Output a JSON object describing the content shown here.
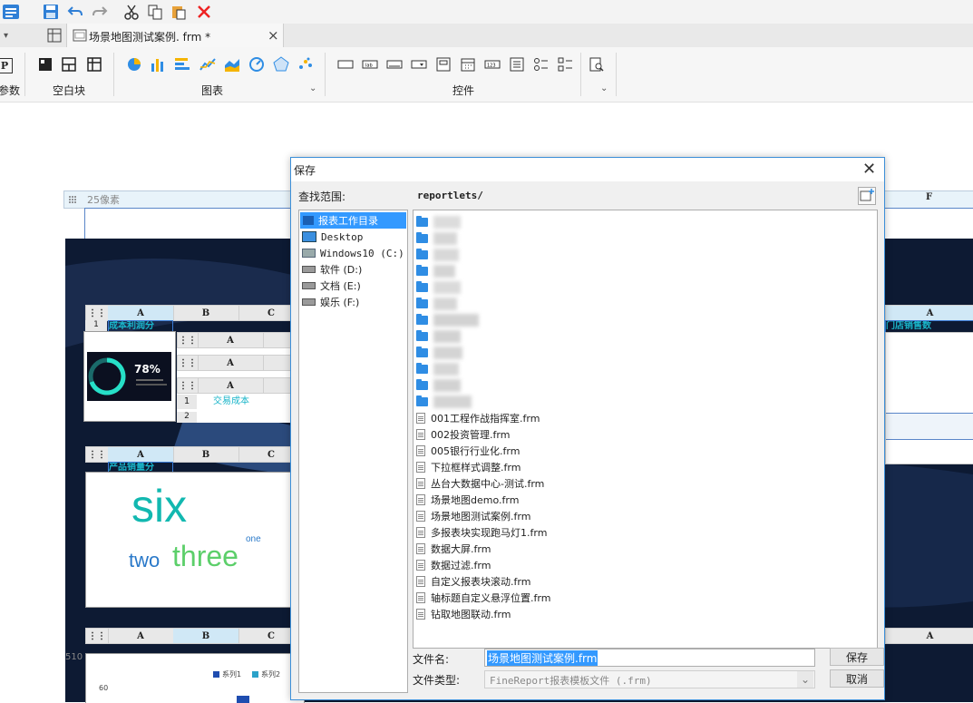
{
  "toolbar": {
    "icons": [
      "app-menu-icon",
      "save-icon",
      "undo-icon",
      "redo-icon",
      "cut-icon",
      "copy-icon",
      "paste-icon",
      "delete-icon"
    ]
  },
  "tabs": {
    "document_tab": "场景地图测试案例. frm *",
    "close_glyph": "×"
  },
  "ribbon": {
    "param_label": "参数",
    "param_icon_text": "P",
    "blank_block_label": "空白块",
    "chart_label": "图表",
    "widget_label": "控件"
  },
  "canvas": {
    "top_note": "25像素",
    "col_f": "F",
    "header_a": "A",
    "header_b": "B",
    "header_c": "C",
    "row1": "1",
    "row2": "2",
    "cell_left_1": "成本利润分",
    "cell_left_2": "产品销量分",
    "cell_right": "门店销售数",
    "cell_trade": "交易成本",
    "gauge_percent": "78%",
    "wordcloud": {
      "big": "six",
      "mid1": "two",
      "mid2": "three",
      "small": "one"
    },
    "bottom_note": "510",
    "legend1": "系列1",
    "legend2": "系列2",
    "axis_60": "60"
  },
  "dialog": {
    "title": "保存",
    "lookin_label": "查找范围:",
    "path": "reportlets/",
    "locations": [
      "报表工作目录",
      "Desktop",
      "Windows10 (C:)",
      "软件 (D:)",
      "文档 (E:)",
      "娱乐 (F:)"
    ],
    "files": [
      "001工程作战指挥室.frm",
      "002投资管理.frm",
      "005银行行业化.frm",
      "下拉框样式调整.frm",
      "丛台大数据中心-测试.frm",
      "场景地图demo.frm",
      "场景地图测试案例.frm",
      "多报表块实现跑马灯1.frm",
      "数据大屏.frm",
      "数据过滤.frm",
      "自定义报表块滚动.frm",
      "轴标题自定义悬浮位置.frm",
      "钻取地图联动.frm"
    ],
    "filename_label": "文件名:",
    "filename_value": "场景地图测试案例.frm",
    "filetype_label": "文件类型:",
    "filetype_value": "FineReport报表模板文件 (.frm)",
    "save_button": "保存",
    "cancel_button": "取消"
  },
  "colors": {
    "accent": "#3399ff",
    "map_bg": "#0d1a33",
    "cyan_text": "#19b5c9"
  }
}
